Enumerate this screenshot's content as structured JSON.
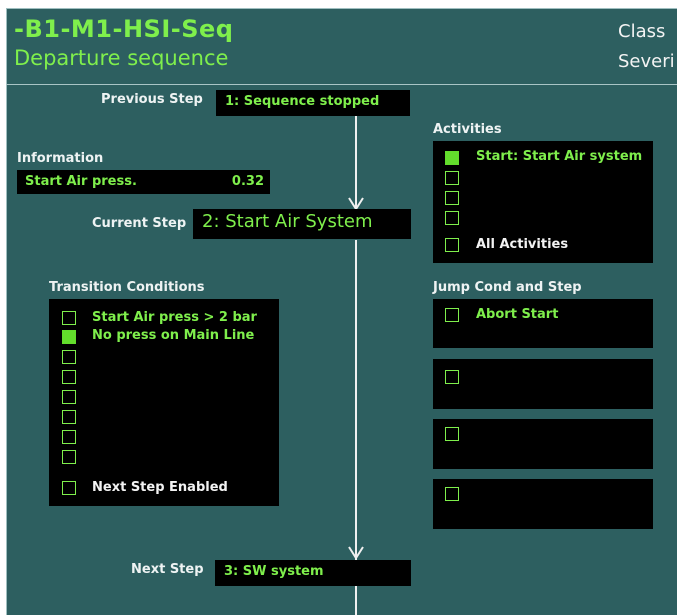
{
  "header": {
    "title": "-B1-M1-HSI-Seq",
    "subtitle": "Departure sequence",
    "class_label": "Class",
    "severity_label": "Severi"
  },
  "steps": {
    "previous_label": "Previous Step",
    "previous_value": "1: Sequence stopped",
    "current_label": "Current Step",
    "current_value": "2: Start Air System",
    "next_label": "Next Step",
    "next_value": "3: SW system"
  },
  "information": {
    "title": "Information",
    "name": "Start Air press.",
    "value": "0.32"
  },
  "transition_conditions": {
    "title": "Transition Conditions",
    "items": [
      {
        "label": "Start Air press > 2 bar",
        "checked": false
      },
      {
        "label": "No press on Main Line",
        "checked": true
      },
      {
        "label": "",
        "checked": false
      },
      {
        "label": "",
        "checked": false
      },
      {
        "label": "",
        "checked": false
      },
      {
        "label": "",
        "checked": false
      },
      {
        "label": "",
        "checked": false
      },
      {
        "label": "",
        "checked": false
      }
    ],
    "next_step_enabled_label": "Next Step Enabled"
  },
  "activities": {
    "title": "Activities",
    "items": [
      {
        "label": "Start: Start Air system",
        "checked": true
      },
      {
        "label": "",
        "checked": false
      },
      {
        "label": "",
        "checked": false
      },
      {
        "label": "",
        "checked": false
      }
    ],
    "all_label": "All Activities"
  },
  "jump": {
    "title": "Jump Cond and Step",
    "items": [
      {
        "label": "Abort Start"
      },
      {
        "label": ""
      },
      {
        "label": ""
      },
      {
        "label": ""
      }
    ]
  },
  "colors": {
    "background": "#2d5f60",
    "accent_green": "#7fef4c",
    "checked_green": "#63dd2c",
    "box_black": "#000000"
  }
}
